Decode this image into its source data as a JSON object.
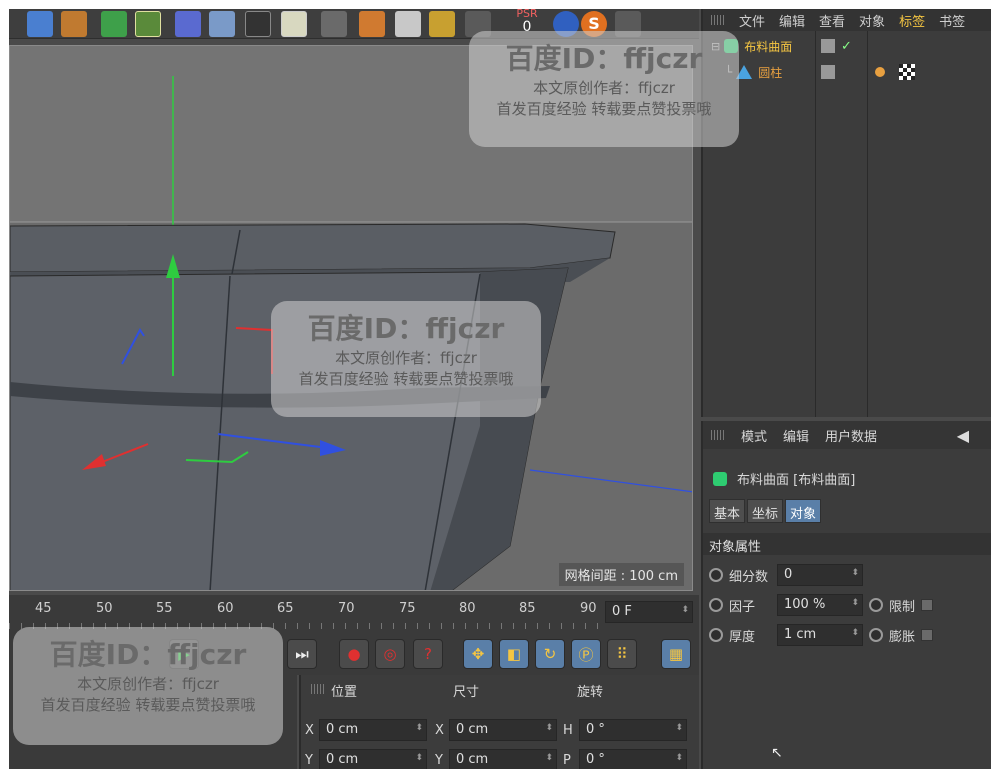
{
  "object_manager": {
    "menu": [
      "文件",
      "编辑",
      "查看",
      "对象",
      "标签",
      "书签"
    ],
    "objects": [
      {
        "name": "布料曲面",
        "icon": "cloth-surface-icon"
      },
      {
        "name": "圆柱",
        "icon": "cylinder-icon"
      }
    ]
  },
  "attribute_manager": {
    "menu": [
      "模式",
      "编辑",
      "用户数据"
    ],
    "object_title": "布料曲面 [布料曲面]",
    "tabs": [
      "基本",
      "坐标",
      "对象"
    ],
    "active_tab": "对象",
    "section": "对象属性",
    "props": {
      "subdivisions_label": "细分数",
      "subdivisions_value": "0",
      "factor_label": "因子",
      "factor_value": "100 %",
      "limit_label": "限制",
      "thickness_label": "厚度",
      "thickness_value": "1 cm",
      "expand_label": "膨胀"
    }
  },
  "viewport": {
    "grid_spacing": "网格间距 : 100 cm"
  },
  "timeline": {
    "ticks": [
      "45",
      "50",
      "55",
      "60",
      "65",
      "70",
      "75",
      "80",
      "85",
      "90"
    ],
    "current_frame": "0 F"
  },
  "coordinates": {
    "headers": [
      "位置",
      "尺寸",
      "旋转"
    ],
    "rows": [
      {
        "pos_label": "X",
        "pos": "0 cm",
        "size_label": "X",
        "size": "0 cm",
        "rot_label": "H",
        "rot": "0 °"
      },
      {
        "pos_label": "Y",
        "pos": "0 cm",
        "size_label": "Y",
        "size": "0 cm",
        "rot_label": "P",
        "rot": "0 °"
      }
    ]
  },
  "toolbar": {
    "counter_label": "PSR",
    "counter_value": "0"
  },
  "watermark": {
    "title": "百度ID：ffjczr",
    "line1": "本文原创作者：ffjczr",
    "line2": "首发百度经验 转载要点赞投票哦"
  },
  "colors": {
    "accent_yellow": "#f4c542",
    "active_tab": "#5a7fa8",
    "axis_x": "#e03030",
    "axis_y": "#2ecc40",
    "axis_z": "#3050e0"
  }
}
